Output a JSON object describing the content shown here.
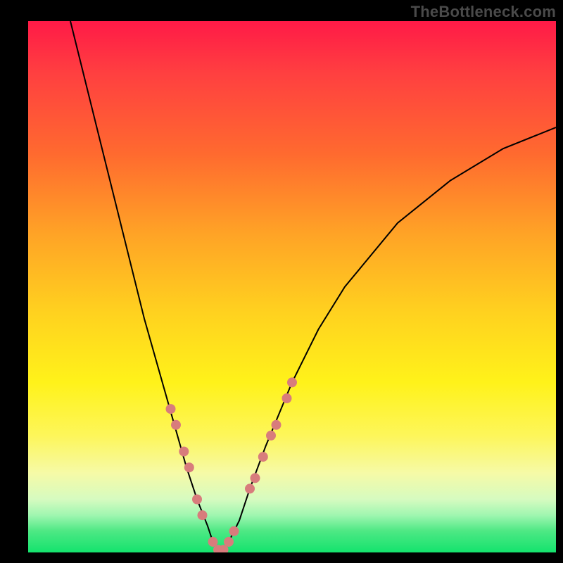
{
  "watermark": "TheBottleneck.com",
  "chart_data": {
    "type": "line",
    "title": "",
    "xlabel": "",
    "ylabel": "",
    "xlim": [
      0,
      100
    ],
    "ylim": [
      0,
      100
    ],
    "series": [
      {
        "name": "bottleneck-curve",
        "x": [
          8,
          10,
          14,
          18,
          22,
          26,
          30,
          32,
          34,
          35,
          36,
          37,
          38,
          40,
          42,
          45,
          50,
          55,
          60,
          70,
          80,
          90,
          100
        ],
        "y": [
          100,
          92,
          76,
          60,
          44,
          30,
          16,
          10,
          5,
          2,
          0.5,
          0.5,
          2,
          6,
          12,
          20,
          32,
          42,
          50,
          62,
          70,
          76,
          80
        ]
      }
    ],
    "markers": {
      "name": "highlighted-points",
      "color": "#d87c7c",
      "x": [
        27,
        28,
        29.5,
        30.5,
        32,
        33,
        35,
        36,
        37,
        38,
        39,
        42,
        43,
        44.5,
        46,
        47,
        49,
        50
      ],
      "y": [
        27,
        24,
        19,
        16,
        10,
        7,
        2,
        0.5,
        0.5,
        2,
        4,
        12,
        14,
        18,
        22,
        24,
        29,
        32
      ]
    },
    "gradient_stops": [
      {
        "offset": 0,
        "color": "#ff1a47"
      },
      {
        "offset": 10,
        "color": "#ff4040"
      },
      {
        "offset": 25,
        "color": "#ff6a2f"
      },
      {
        "offset": 40,
        "color": "#ffa326"
      },
      {
        "offset": 55,
        "color": "#ffd21f"
      },
      {
        "offset": 68,
        "color": "#fff21a"
      },
      {
        "offset": 78,
        "color": "#fdf65a"
      },
      {
        "offset": 85,
        "color": "#f6faa6"
      },
      {
        "offset": 90,
        "color": "#d6fbc0"
      },
      {
        "offset": 93,
        "color": "#9ff6b0"
      },
      {
        "offset": 96,
        "color": "#4de884"
      },
      {
        "offset": 100,
        "color": "#14e36d"
      }
    ]
  }
}
